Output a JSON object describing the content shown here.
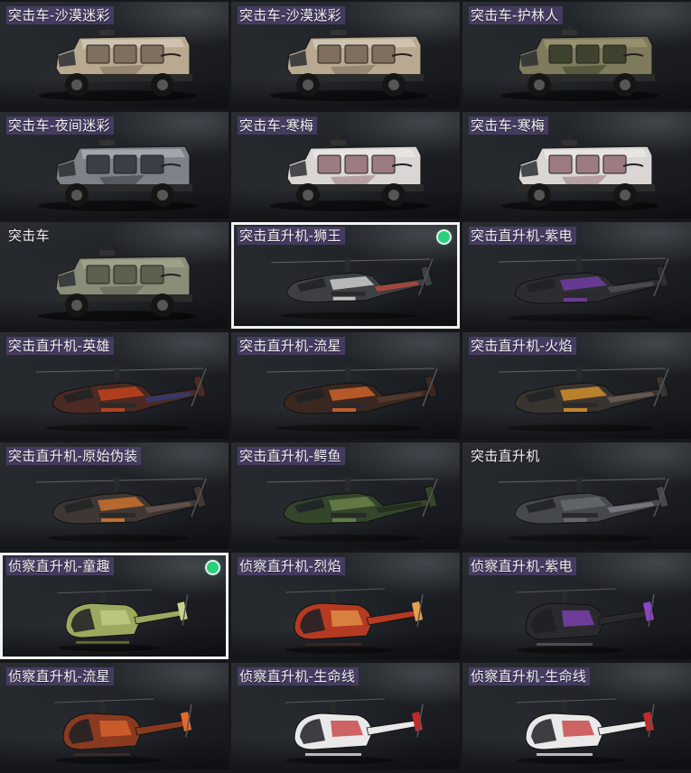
{
  "skins": [
    {
      "label": "突击车-沙漠迷彩",
      "kind": "truck",
      "body": "#b9a991",
      "accent": "#7e6f5e",
      "light": "#e1d8cb",
      "tag": "true",
      "equipped": false,
      "selected": false
    },
    {
      "label": "突击车-沙漠迷彩",
      "kind": "truck",
      "body": "#b9a991",
      "accent": "#7e6f5e",
      "light": "#e1d8cb",
      "tag": "true",
      "equipped": false,
      "selected": false
    },
    {
      "label": "突击车-护林人",
      "kind": "truck",
      "body": "#7e7a5c",
      "accent": "#3f422f",
      "light": "#a9a37e",
      "tag": "true",
      "equipped": false,
      "selected": false
    },
    {
      "label": "突击车-夜间迷彩",
      "kind": "truck",
      "body": "#7d8288",
      "accent": "#3a3f47",
      "light": "#c1c5ca",
      "tag": "true",
      "equipped": false,
      "selected": false
    },
    {
      "label": "突击车-寒梅",
      "kind": "truck",
      "body": "#d9d6d4",
      "accent": "#9c7b81",
      "light": "#f2f0ee",
      "tag": "true",
      "equipped": false,
      "selected": false
    },
    {
      "label": "突击车-寒梅",
      "kind": "truck",
      "body": "#d9d6d4",
      "accent": "#9c7b81",
      "light": "#f2f0ee",
      "tag": "true",
      "equipped": false,
      "selected": false
    },
    {
      "label": "突击车",
      "kind": "truck",
      "body": "#8a8d77",
      "accent": "#5d604f",
      "light": "#aeb19b",
      "tag": "false",
      "equipped": false,
      "selected": false
    },
    {
      "label": "突击直升机-狮王",
      "kind": "heli",
      "body": "#3e3f42",
      "accent": "#e0e0e0",
      "light": "#d14a3b",
      "tag": "true",
      "equipped": true,
      "selected": true
    },
    {
      "label": "突击直升机-紫电",
      "kind": "heli",
      "body": "#2c2d31",
      "accent": "#7a3fb0",
      "light": "#555860",
      "tag": "true",
      "equipped": false,
      "selected": false
    },
    {
      "label": "突击直升机-英雄",
      "kind": "heli",
      "body": "#4a2a22",
      "accent": "#d2461f",
      "light": "#2d3f88",
      "tag": "true",
      "equipped": false,
      "selected": false
    },
    {
      "label": "突击直升机-流星",
      "kind": "heli",
      "body": "#3a2720",
      "accent": "#e16a2c",
      "light": "#5b4035",
      "tag": "true",
      "equipped": false,
      "selected": false
    },
    {
      "label": "突击直升机-火焰",
      "kind": "heli",
      "body": "#3a3431",
      "accent": "#e59a2a",
      "light": "#76695f",
      "tag": "true",
      "equipped": false,
      "selected": false
    },
    {
      "label": "突击直升机-原始伪装",
      "kind": "heli",
      "body": "#3f3733",
      "accent": "#e07a2f",
      "light": "#6d5d55",
      "tag": "true",
      "equipped": false,
      "selected": false
    },
    {
      "label": "突击直升机-鳄鱼",
      "kind": "heli",
      "body": "#33452b",
      "accent": "#6f8a4d",
      "light": "#1f2a1b",
      "tag": "true",
      "equipped": false,
      "selected": false
    },
    {
      "label": "突击直升机",
      "kind": "heli",
      "body": "#45484d",
      "accent": "#6a6d73",
      "light": "#888b91",
      "tag": "false",
      "equipped": false,
      "selected": false
    },
    {
      "label": "侦察直升机-童趣",
      "kind": "scout",
      "body": "#9aa95d",
      "accent": "#c7d28c",
      "light": "#5f6a34",
      "tag": "true",
      "equipped": true,
      "selected": true
    },
    {
      "label": "侦察直升机-烈焰",
      "kind": "scout",
      "body": "#b63a22",
      "accent": "#e7a04c",
      "light": "#3b2520",
      "tag": "true",
      "equipped": false,
      "selected": false
    },
    {
      "label": "侦察直升机-紫电",
      "kind": "scout",
      "body": "#2a2a2e",
      "accent": "#8c44c8",
      "light": "#4d4d52",
      "tag": "true",
      "equipped": false,
      "selected": false
    },
    {
      "label": "侦察直升机-流星",
      "kind": "scout",
      "body": "#8a3a20",
      "accent": "#e36a2c",
      "light": "#3b2a24",
      "tag": "true",
      "equipped": false,
      "selected": false
    },
    {
      "label": "侦察直升机-生命线",
      "kind": "scout",
      "body": "#e9e9e9",
      "accent": "#c22a2a",
      "light": "#b9b9b9",
      "tag": "true",
      "equipped": false,
      "selected": false
    },
    {
      "label": "侦察直升机-生命线",
      "kind": "scout",
      "body": "#e9e9e9",
      "accent": "#c22a2a",
      "light": "#b9b9b9",
      "tag": "true",
      "equipped": false,
      "selected": false
    }
  ]
}
